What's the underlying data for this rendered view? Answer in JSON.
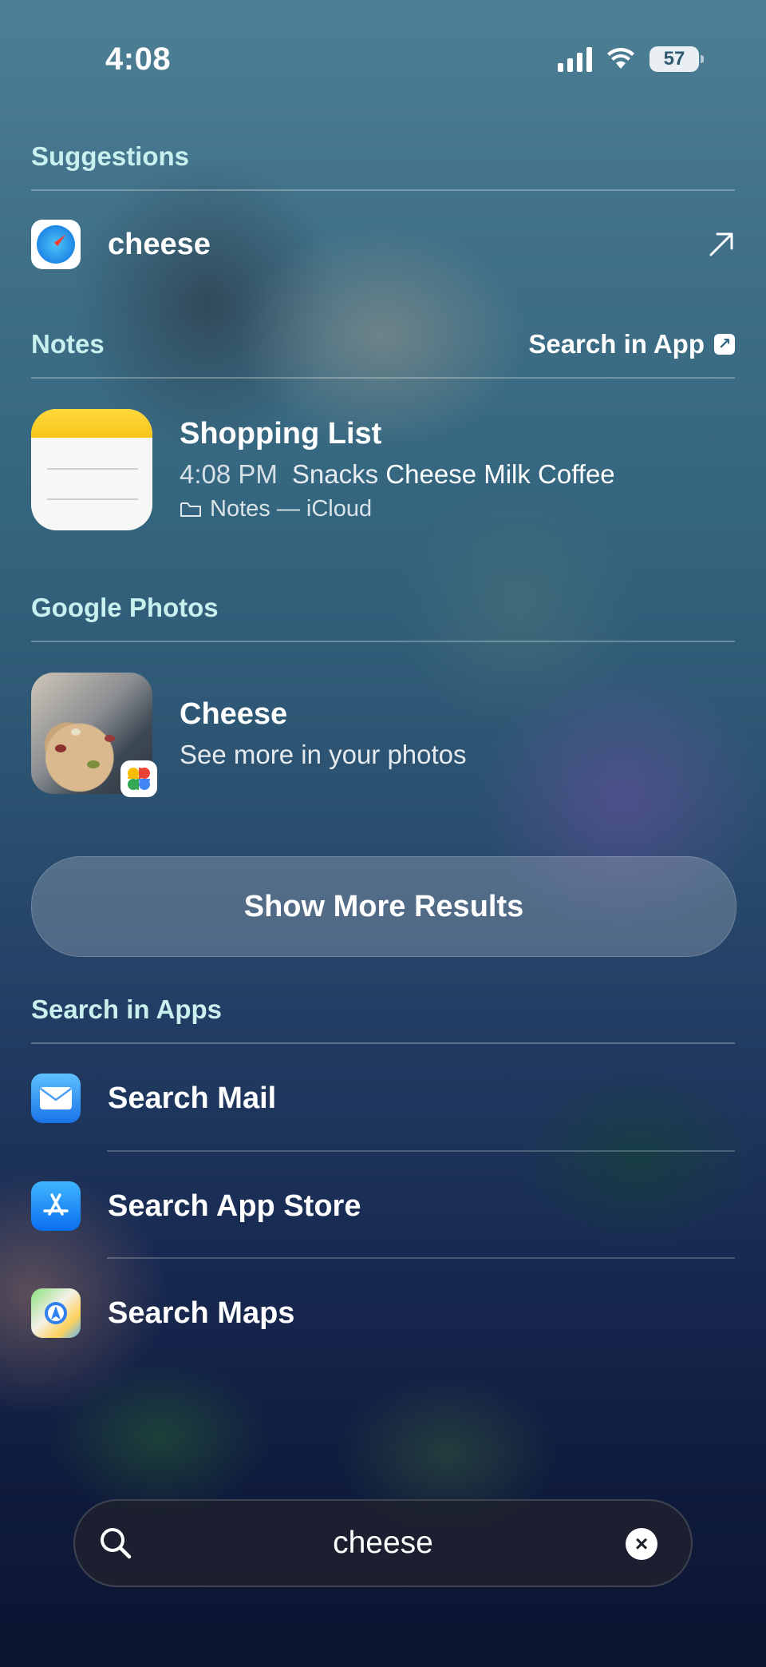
{
  "status_bar": {
    "time": "4:08",
    "battery": "57"
  },
  "suggestions": {
    "header": "Suggestions",
    "items": [
      {
        "icon": "safari-icon",
        "label": "cheese",
        "action_icon": "arrow-up-right-icon"
      }
    ]
  },
  "notes": {
    "header": "Notes",
    "search_in_app": "Search in App",
    "result": {
      "title": "Shopping List",
      "time": "4:08 PM",
      "snippet_plain": "Snacks",
      "snippet_bold": "Cheese Milk Coffee",
      "location": "Notes — iCloud"
    }
  },
  "google_photos": {
    "header": "Google Photos",
    "result": {
      "title": "Cheese",
      "subtitle": "See more in your photos"
    }
  },
  "show_more": "Show More Results",
  "search_in_apps": {
    "header": "Search in Apps",
    "items": [
      {
        "icon": "mail-icon",
        "label": "Search Mail"
      },
      {
        "icon": "app-store-icon",
        "label": "Search App Store"
      },
      {
        "icon": "maps-icon",
        "label": "Search Maps"
      }
    ]
  },
  "search_bar": {
    "value": "cheese"
  },
  "colors": {
    "section_header": "#c8f0ee",
    "text": "#ffffff"
  }
}
